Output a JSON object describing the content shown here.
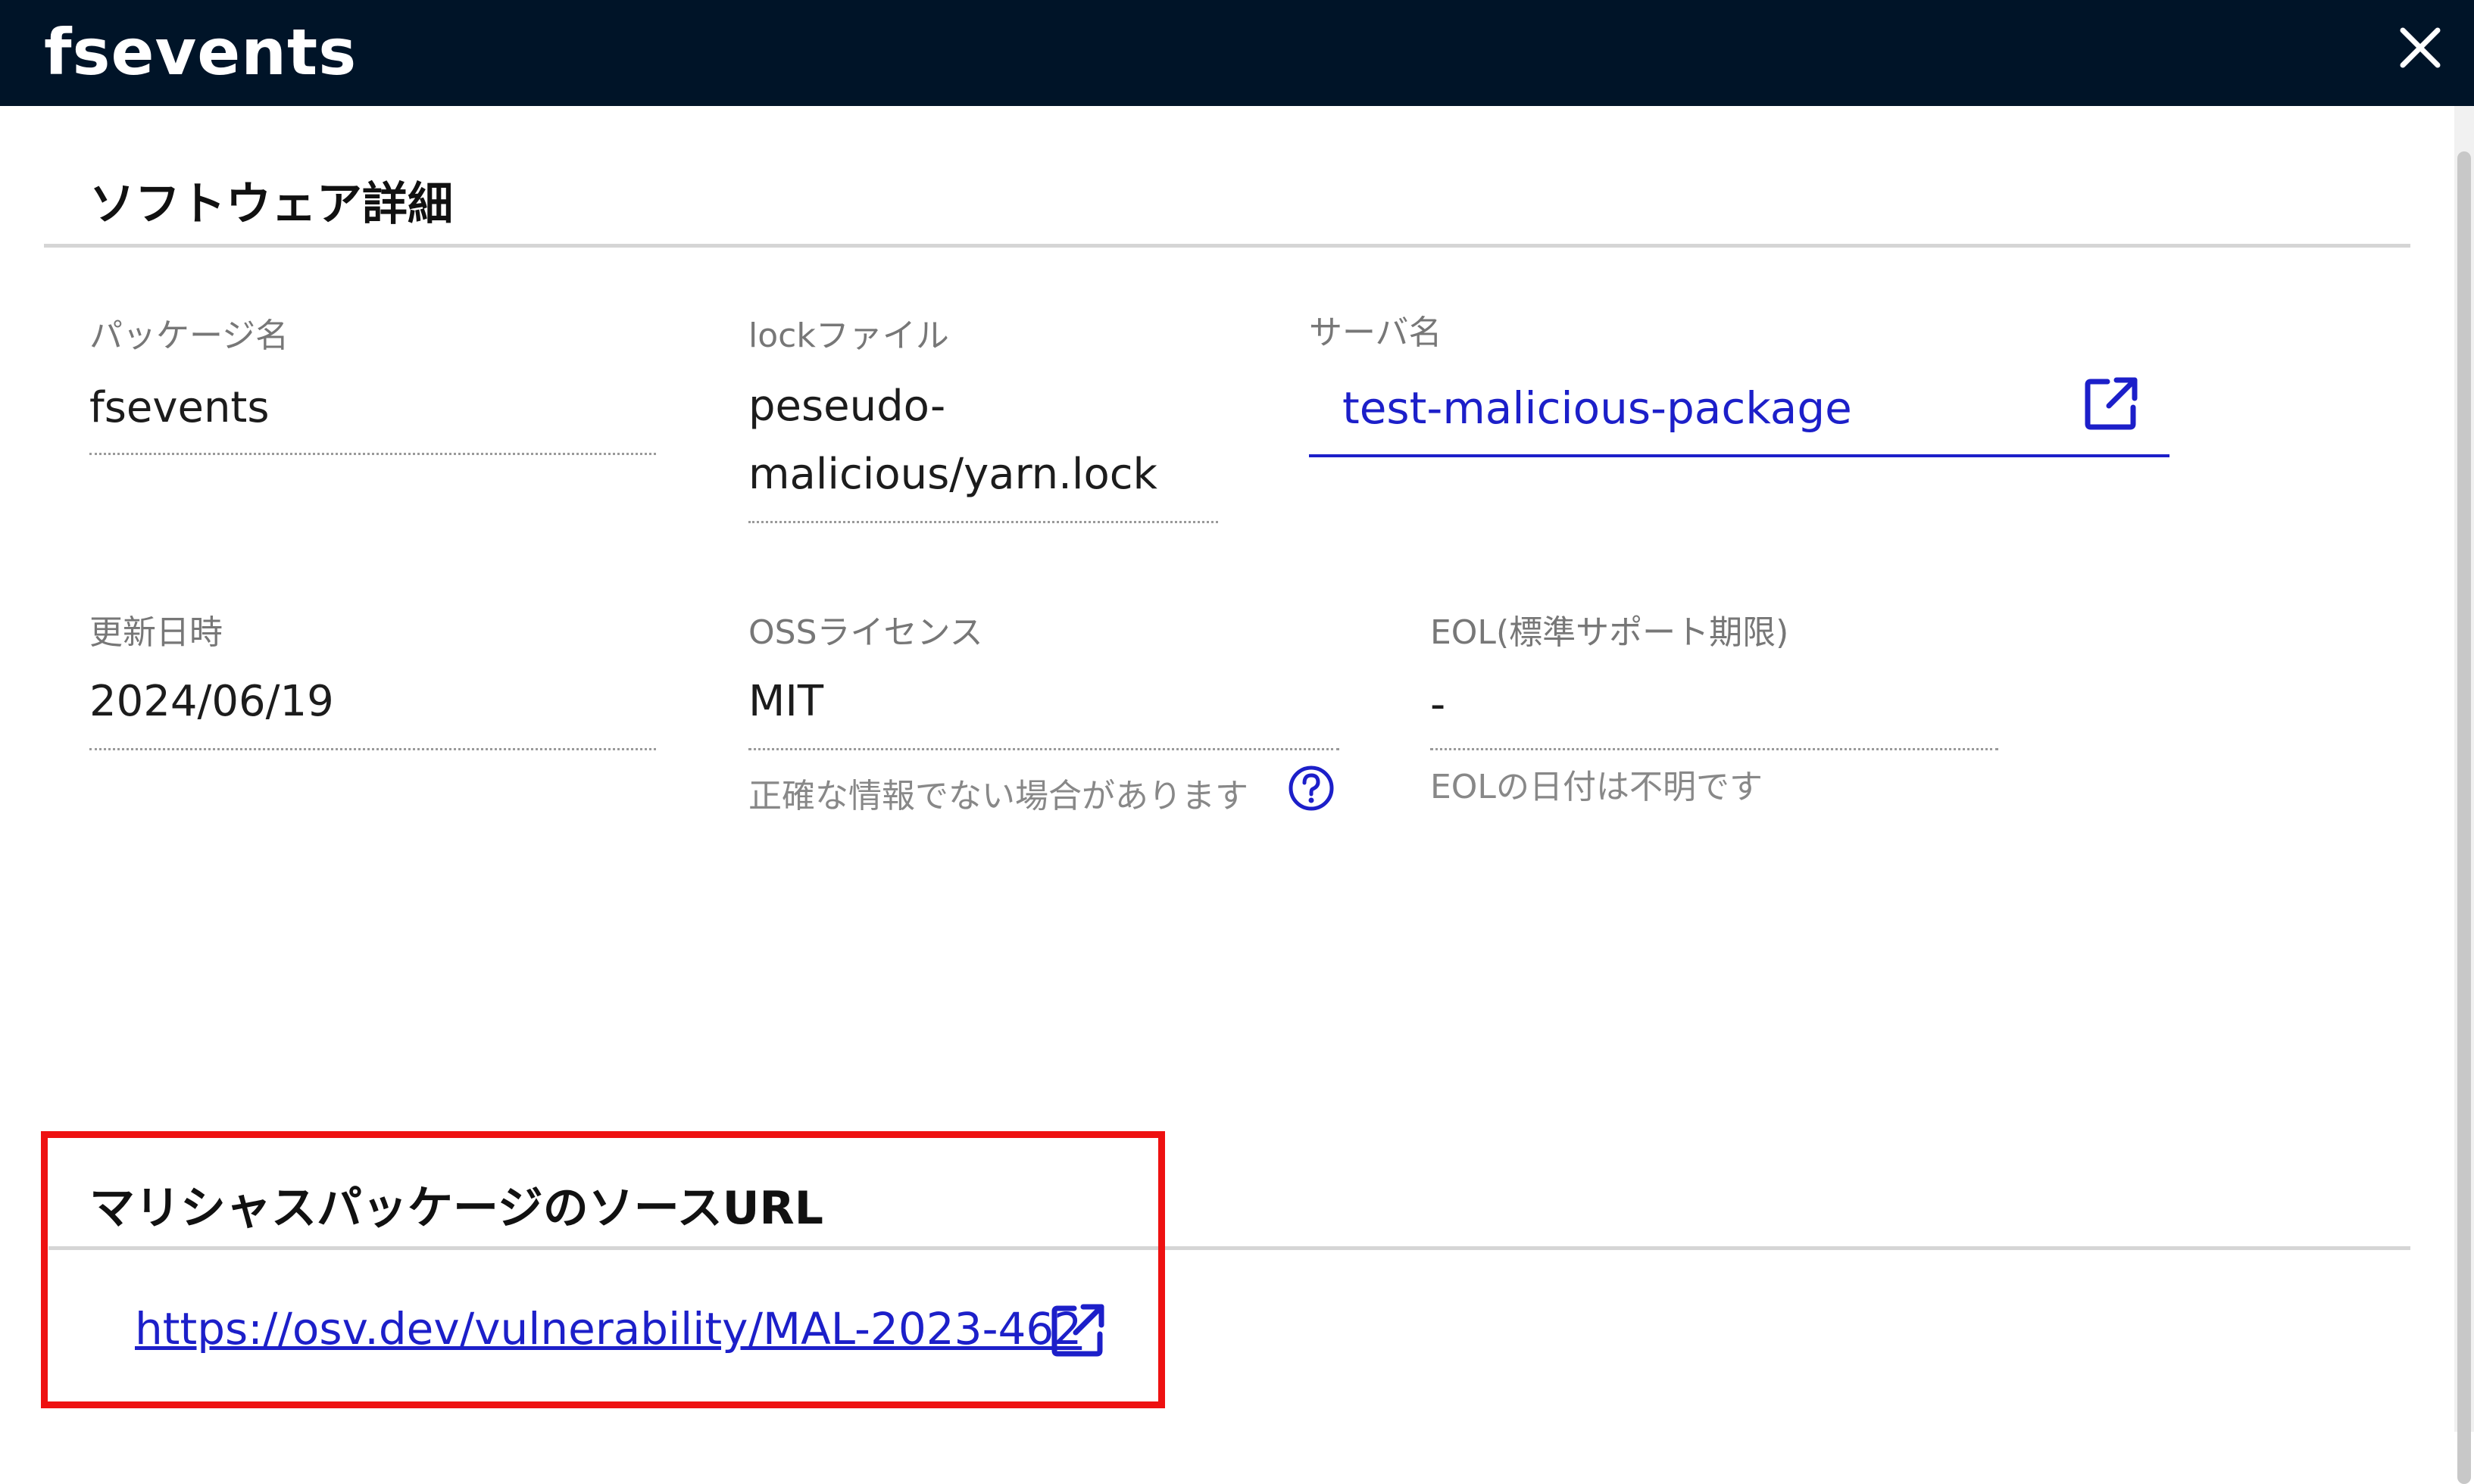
{
  "window": {
    "title": "fsevents",
    "close_icon": "close-icon"
  },
  "software_details": {
    "section_title": "ソフトウェア詳細",
    "package_name": {
      "label": "パッケージ名",
      "value": "fsevents"
    },
    "lock_file": {
      "label": "lockファイル",
      "value_line1": "peseudo-",
      "value_line2": "malicious/yarn.lock"
    },
    "server_name": {
      "label": "サーバ名",
      "value": "test-malicious-package",
      "icon": "external-link-icon"
    },
    "updated_at": {
      "label": "更新日時",
      "value": "2024/06/19"
    },
    "oss_license": {
      "label": "OSSライセンス",
      "value": "MIT",
      "note": "正確な情報でない場合があります",
      "help_icon": "question-circle-icon"
    },
    "eol": {
      "label": "EOL(標準サポート期限)",
      "value": "-",
      "note": "EOLの日付は不明です"
    }
  },
  "malicious_source": {
    "section_title": "マリシャスパッケージのソースURL",
    "url": "https://osv.dev/vulnerability/MAL-2023-462",
    "icon": "external-link-icon"
  },
  "colors": {
    "titlebar_bg": "#001428",
    "link": "#1c1fc9",
    "highlight": "#ee1111"
  }
}
